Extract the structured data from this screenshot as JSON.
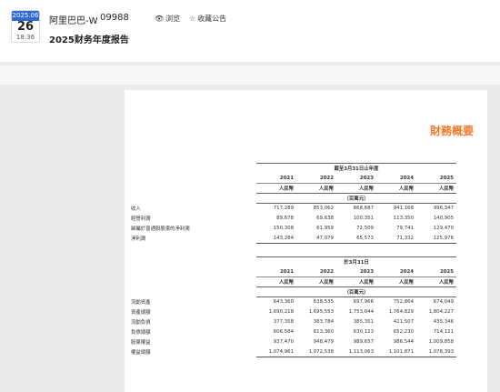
{
  "header": {
    "date_ym": "2025.06",
    "date_day": "26",
    "date_time": "18:36",
    "company": "阿里巴巴-W",
    "stock_code": "09988",
    "view_label": "浏览",
    "favorite_label": "收藏公告",
    "report_title": "2025财务年度报告",
    "accent_color": "#2f6ad8"
  },
  "document": {
    "heading": "財務概要",
    "heading_color": "#f07a2a",
    "table1": {
      "period_caption": "截至3月31日止年度",
      "years": [
        "2021",
        "2022",
        "2023",
        "2024",
        "2025"
      ],
      "currency": "人民幣",
      "unit": "（百萬元）",
      "rows": [
        {
          "label": "收入",
          "values": [
            "717,289",
            "853,062",
            "868,687",
            "941,168",
            "996,347"
          ]
        },
        {
          "label": "經營利潤",
          "values": [
            "89,678",
            "69,638",
            "100,351",
            "113,350",
            "140,905"
          ]
        },
        {
          "label": "歸屬於普通股股東的淨利潤",
          "values": [
            "150,308",
            "61,959",
            "72,509",
            "79,741",
            "129,470"
          ]
        },
        {
          "label": "淨利潤",
          "values": [
            "143,284",
            "47,079",
            "65,573",
            "71,332",
            "125,976"
          ]
        }
      ]
    },
    "table2": {
      "period_caption": "於3月31日",
      "years": [
        "2021",
        "2022",
        "2023",
        "2024",
        "2025"
      ],
      "currency": "人民幣",
      "unit": "（百萬元）",
      "rows": [
        {
          "label": "流動資產",
          "values": [
            "643,360",
            "638,535",
            "697,966",
            "752,864",
            "674,049"
          ]
        },
        {
          "label": "資產總額",
          "values": [
            "1,690,218",
            "1,695,553",
            "1,753,044",
            "1,764,829",
            "1,804,227"
          ]
        },
        {
          "label": "流動負債",
          "values": [
            "377,358",
            "383,784",
            "385,351",
            "421,507",
            "435,346"
          ]
        },
        {
          "label": "負債總額",
          "values": [
            "606,584",
            "613,360",
            "630,123",
            "652,230",
            "714,121"
          ]
        },
        {
          "label": "股東權益",
          "values": [
            "937,470",
            "948,479",
            "989,657",
            "986,544",
            "1,009,858"
          ]
        },
        {
          "label": "權益總額",
          "values": [
            "1,074,961",
            "1,072,538",
            "1,113,063",
            "1,101,871",
            "1,078,393"
          ]
        }
      ]
    }
  }
}
